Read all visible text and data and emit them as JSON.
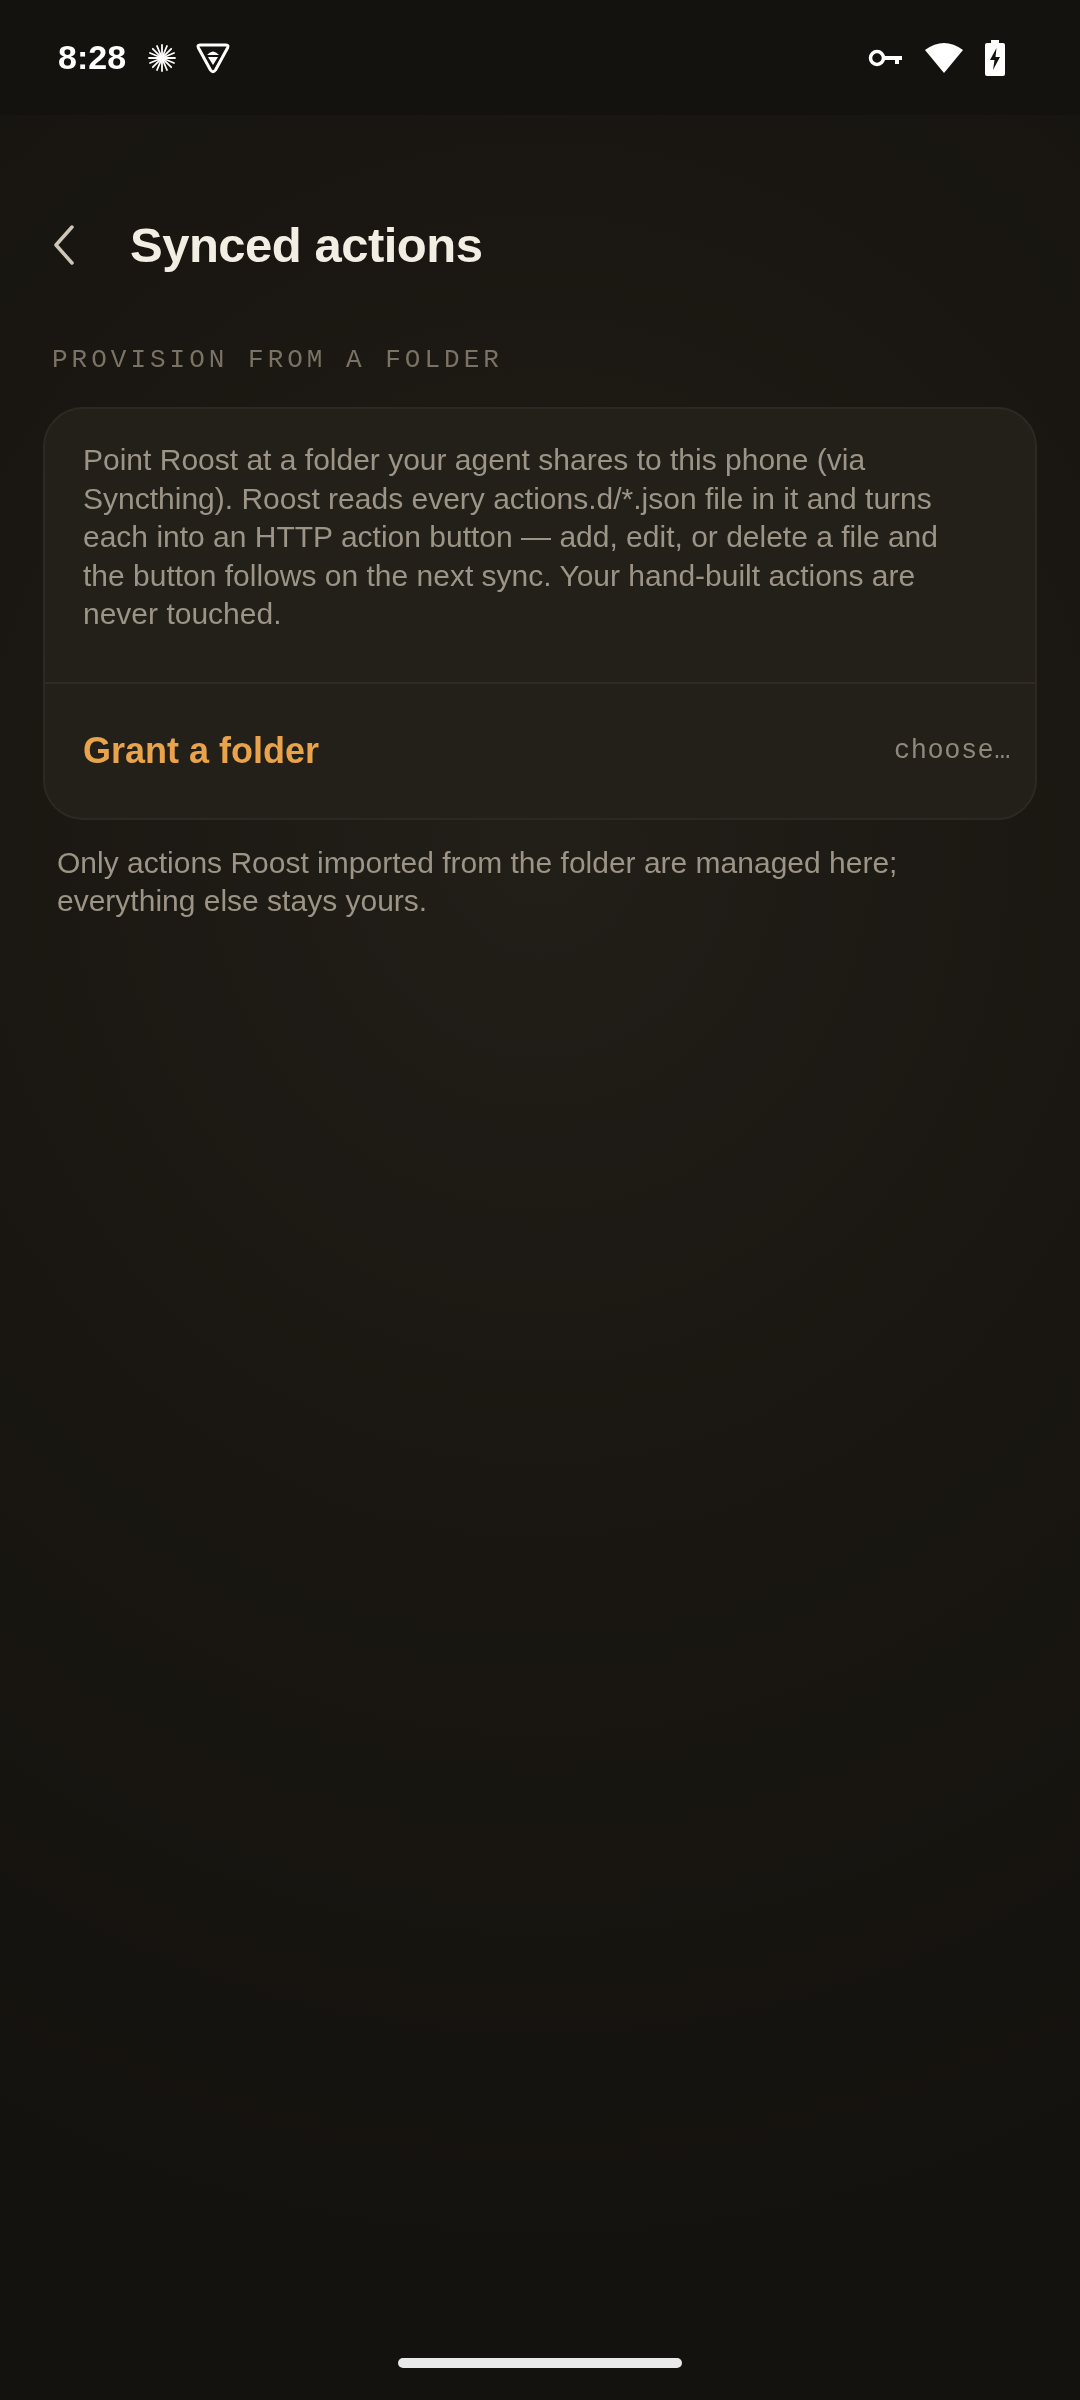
{
  "status_bar": {
    "time": "8:28"
  },
  "header": {
    "title": "Synced actions"
  },
  "section": {
    "label": "PROVISION FROM A FOLDER"
  },
  "card": {
    "description": "Point Roost at a folder your agent shares to this phone (via Syncthing). Roost reads every actions.d/*.json file in it and turns each into an HTTP action button — add, edit, or delete a file and the button follows on the next sync. Your hand-built actions are never touched.",
    "action": {
      "label": "Grant a folder",
      "value": "choose…"
    }
  },
  "footnote": "Only actions Roost imported from the folder are managed here; everything else stays yours."
}
